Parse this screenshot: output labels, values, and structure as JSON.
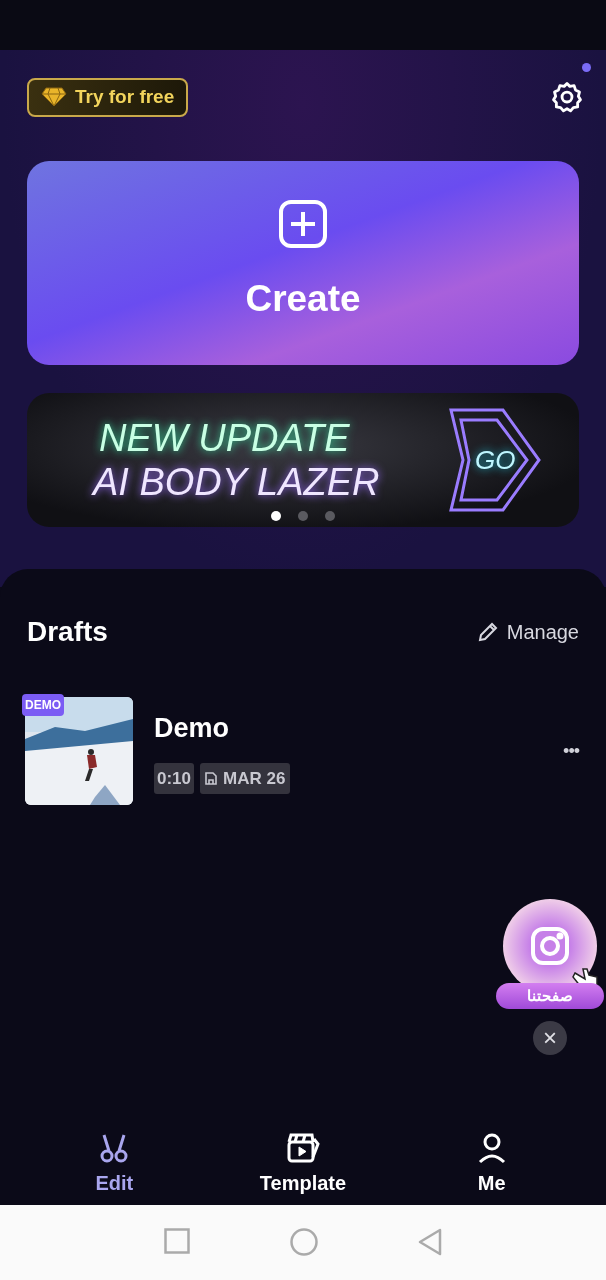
{
  "header": {
    "promo_button": "Try for free",
    "settings_dot": true
  },
  "create_card": {
    "label": "Create"
  },
  "banner": {
    "line_1": "NEW UPDATE",
    "line_2": "AI BODY LAZER",
    "go": "GO",
    "pages": [
      {
        "selected": true
      },
      {
        "selected": false
      },
      {
        "selected": false
      }
    ]
  },
  "drafts": {
    "title": "Drafts",
    "manage": "Manage",
    "items": [
      {
        "badge": "DEMO",
        "name": "Demo",
        "duration": "0:10",
        "date": "MAR 26",
        "more": "•••"
      }
    ]
  },
  "floating_promo": {
    "label": "صفحتنا",
    "close": "×"
  },
  "bottom_nav": [
    {
      "label": "Edit",
      "kind": "edit",
      "selected": true
    },
    {
      "label": "Template",
      "kind": "template",
      "selected": false
    },
    {
      "label": "Me",
      "kind": "me",
      "selected": false
    }
  ]
}
